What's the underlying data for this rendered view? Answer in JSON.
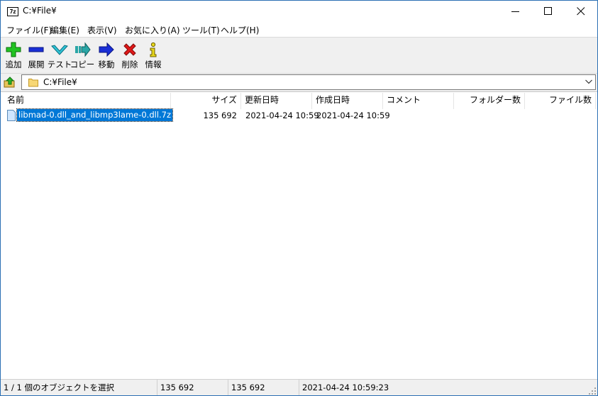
{
  "window": {
    "title": "C:¥File¥"
  },
  "app_icon_text": "7z",
  "menu": [
    "ファイル(F)",
    "編集(E)",
    "表示(V)",
    "お気に入り(A)",
    "ツール(T)",
    "ヘルプ(H)"
  ],
  "toolbar": {
    "add": "追加",
    "extract": "展開",
    "test": "テスト",
    "copy": "コピー",
    "move": "移動",
    "delete": "削除",
    "info": "情報"
  },
  "address": {
    "path": "C:¥File¥"
  },
  "columns": {
    "name": "名前",
    "size": "サイズ",
    "modified": "更新日時",
    "created": "作成日時",
    "comment": "コメント",
    "folders": "フォルダー数",
    "files": "ファイル数"
  },
  "files": [
    {
      "name": "libmad-0.dll_and_libmp3lame-0.dll.7z",
      "size": "135 692",
      "modified": "2021-04-24 10:59",
      "created": "2021-04-24 10:59"
    }
  ],
  "status": {
    "selection": "1 / 1 個のオブジェクトを選択",
    "size1": "135 692",
    "size2": "135 692",
    "datetime": "2021-04-24 10:59:23"
  },
  "colors": {
    "selection": "#0078d7",
    "toolbar_bg": "#f0f0f0",
    "border": "#2b6fb3"
  }
}
